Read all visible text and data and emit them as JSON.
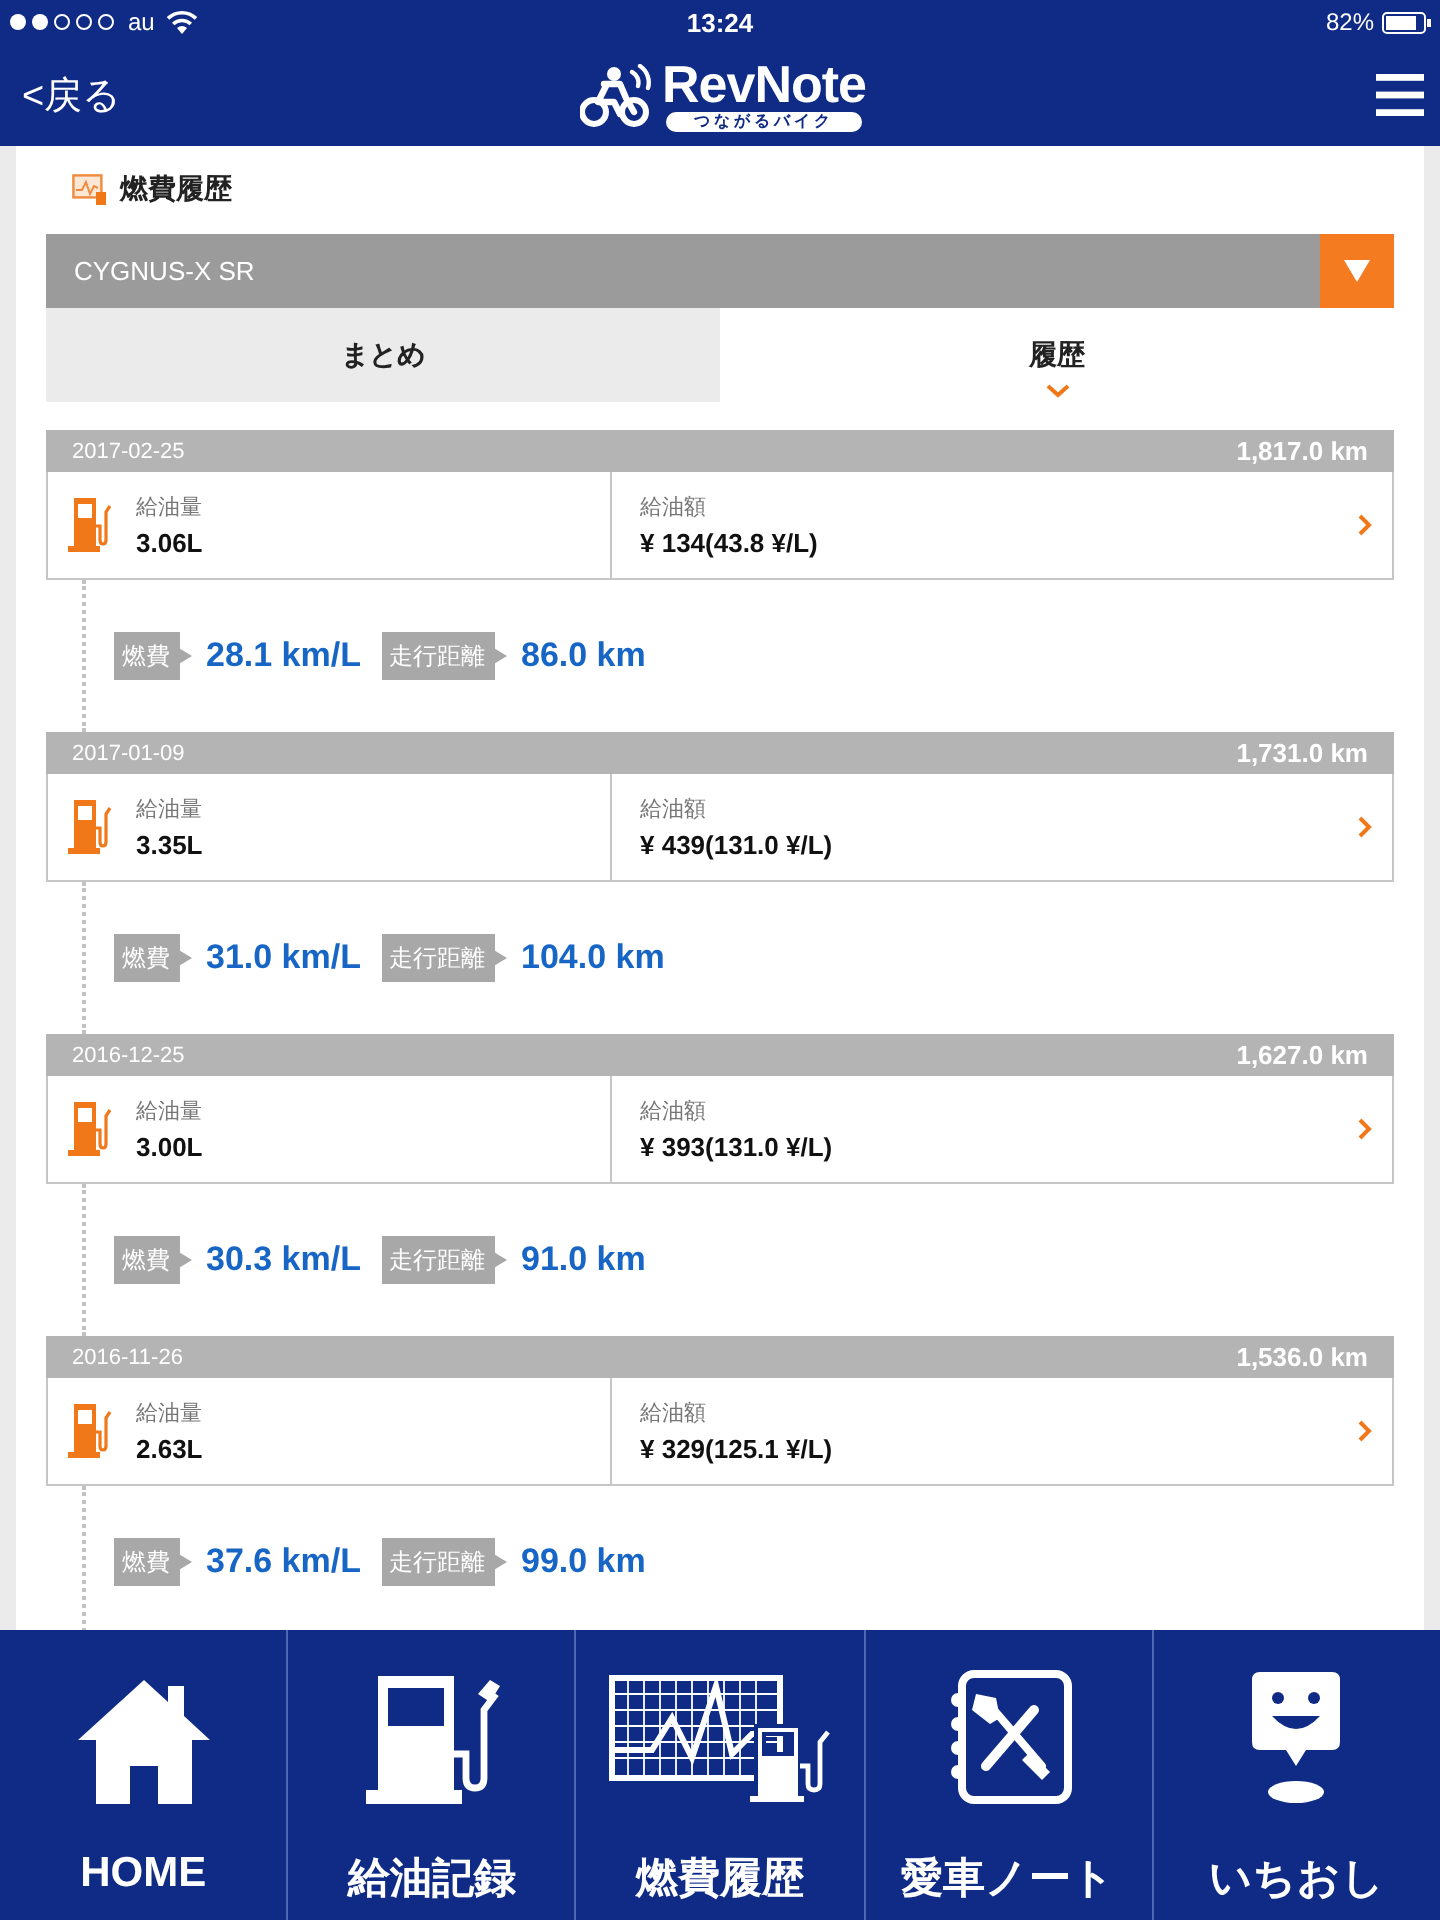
{
  "status_bar": {
    "carrier": "au",
    "time": "13:24",
    "battery": "82%"
  },
  "nav_bar": {
    "back": "<戻る",
    "logo_title": "RevNote",
    "logo_subtitle": "つながるバイク"
  },
  "section": {
    "title": "燃費履歴"
  },
  "vehicle_select": {
    "value": "CYGNUS-X SR"
  },
  "tabs": [
    {
      "label": "まとめ",
      "selected": false
    },
    {
      "label": "履歴",
      "selected": true
    }
  ],
  "entries": [
    {
      "date": "2017-02-25",
      "odometer": "1,817.0 km",
      "amount_label": "給油量",
      "amount": "3.06L",
      "cost_label": "給油額",
      "cost": "¥ 134(43.8 ¥/L)",
      "efficiency_label": "燃費",
      "efficiency": "28.1 km/L",
      "distance_label": "走行距離",
      "distance": "86.0 km"
    },
    {
      "date": "2017-01-09",
      "odometer": "1,731.0 km",
      "amount_label": "給油量",
      "amount": "3.35L",
      "cost_label": "給油額",
      "cost": "¥ 439(131.0 ¥/L)",
      "efficiency_label": "燃費",
      "efficiency": "31.0 km/L",
      "distance_label": "走行距離",
      "distance": "104.0 km"
    },
    {
      "date": "2016-12-25",
      "odometer": "1,627.0 km",
      "amount_label": "給油量",
      "amount": "3.00L",
      "cost_label": "給油額",
      "cost": "¥ 393(131.0 ¥/L)",
      "efficiency_label": "燃費",
      "efficiency": "30.3 km/L",
      "distance_label": "走行距離",
      "distance": "91.0 km"
    },
    {
      "date": "2016-11-26",
      "odometer": "1,536.0 km",
      "amount_label": "給油量",
      "amount": "2.63L",
      "cost_label": "給油額",
      "cost": "¥ 329(125.1 ¥/L)",
      "efficiency_label": "燃費",
      "efficiency": "37.6 km/L",
      "distance_label": "走行距離",
      "distance": "99.0 km"
    }
  ],
  "tab_bar": [
    {
      "label": "HOME",
      "kind": "home"
    },
    {
      "label": "給油記録",
      "kind": "fuel"
    },
    {
      "label": "燃費履歴",
      "kind": "chart"
    },
    {
      "label": "愛車ノート",
      "kind": "note"
    },
    {
      "label": "いちおし",
      "kind": "pick"
    }
  ]
}
